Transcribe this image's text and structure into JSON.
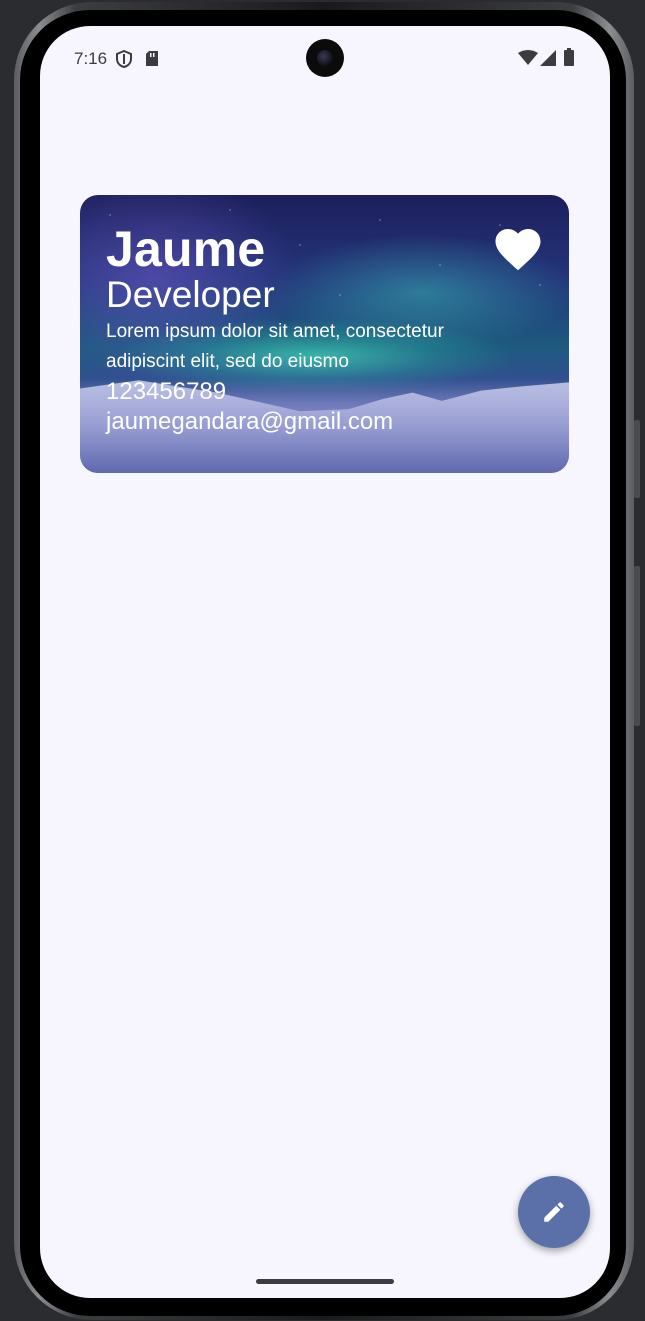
{
  "status_bar": {
    "time": "7:16",
    "left_icons": [
      "shield-icon",
      "sd-card-icon"
    ],
    "right_icons": [
      "wifi-icon",
      "cell-signal-icon",
      "battery-icon"
    ]
  },
  "card": {
    "name": "Jaume",
    "role": "Developer",
    "description": "Lorem ipsum dolor sit amet, consectetur adipiscint elit, sed do eiusmo",
    "phone": "123456789",
    "email": "jaumegandara@gmail.com",
    "favorite_icon": "heart-icon",
    "favorited": true
  },
  "fab": {
    "icon": "pencil-icon"
  },
  "colors": {
    "background": "#f7f5fd",
    "fab": "#5b6fa8",
    "card_text": "#ffffff"
  }
}
